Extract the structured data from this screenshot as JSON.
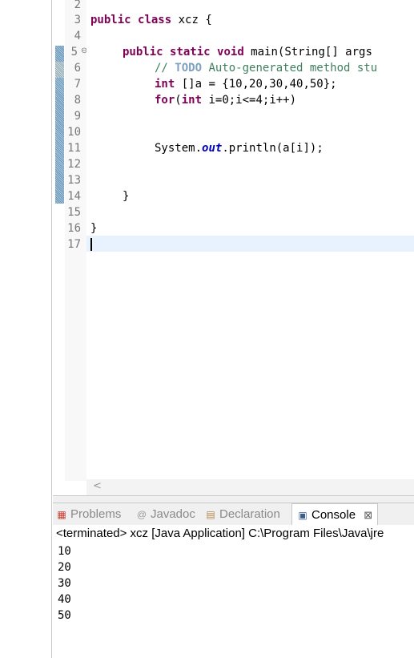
{
  "editor": {
    "line_numbers": [
      "2",
      "3",
      "4",
      "5",
      "6",
      "7",
      "8",
      "9",
      "10",
      "11",
      "12",
      "13",
      "14",
      "15",
      "16",
      "17"
    ],
    "fold_marker": "⊖",
    "line3": {
      "kw1": "public",
      "kw2": "class",
      "rest": " xcz {"
    },
    "line5": {
      "kw1": "public",
      "kw2": "static",
      "kw3": "void",
      "rest": " main(String[] args"
    },
    "line6": {
      "comment_start": "// ",
      "todo": "TODO",
      "comment_rest": " Auto-generated method stu"
    },
    "line7": {
      "kw": "int",
      "rest": " []a = {10,20,30,40,50};"
    },
    "line8": {
      "kw1": "for",
      "p1": "(",
      "kw2": "int",
      "rest": " i=0;i<=4;i++)"
    },
    "line11": {
      "pre": "System.",
      "field": "out",
      "post": ".println(a[i]);"
    },
    "line14": "}",
    "line16": "}"
  },
  "scrollbar": {
    "left_arrow": "<"
  },
  "tabs": {
    "problems": "Problems",
    "javadoc": "Javadoc",
    "declaration": "Declaration",
    "console": "Console",
    "console_close": "⊠"
  },
  "console": {
    "terminated": "<terminated> xcz [Java Application] C:\\Program Files\\Java\\jre",
    "output": [
      "10",
      "20",
      "30",
      "40",
      "50"
    ]
  }
}
